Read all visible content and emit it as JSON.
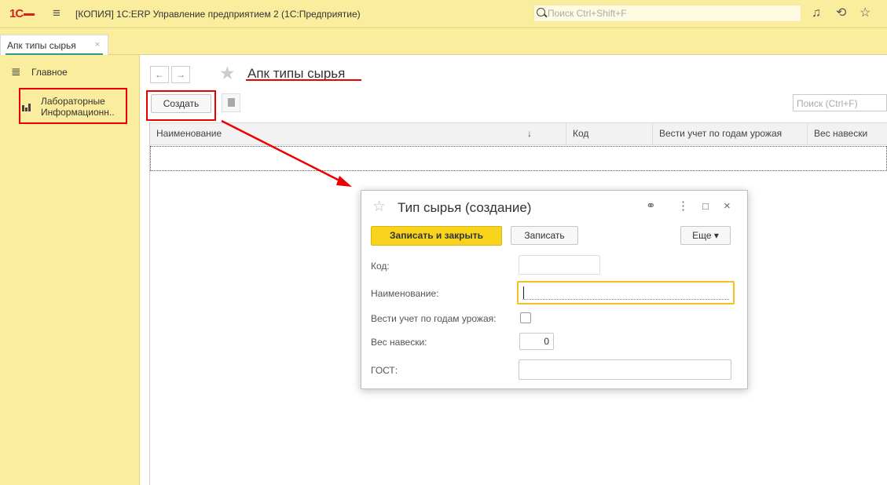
{
  "app": {
    "logo": "1С",
    "title": "[КОПИЯ] 1С:ERP Управление предприятием 2  (1С:Предприятие)",
    "search_placeholder": "Поиск Ctrl+Shift+F"
  },
  "tabs": [
    {
      "label": "Апк типы сырья",
      "close": "×"
    }
  ],
  "sidebar": {
    "items": [
      {
        "label": "Главное",
        "icon": "menu-icon"
      },
      {
        "label_line1": "Лабораторные",
        "label_line2": "Информационн..",
        "icon": "lab-icon"
      }
    ]
  },
  "list_form": {
    "title": "Апк типы сырья",
    "create_button": "Создать",
    "search_placeholder": "Поиск (Ctrl+F)",
    "columns": [
      "Наименование",
      "Код",
      "Вести учет по годам урожая",
      "Вес навески"
    ],
    "sort_indicator": "↓"
  },
  "dialog": {
    "title": "Тип сырья (создание)",
    "save_close_button": "Записать и закрыть",
    "save_button": "Записать",
    "more_button": "Еще ▾",
    "fields": {
      "code_label": "Код:",
      "code_value": "",
      "name_label": "Наименование:",
      "name_value": "",
      "harvest_label": "Вести учет по годам урожая:",
      "harvest_checked": false,
      "weight_label": "Вес навески:",
      "weight_value": "0",
      "gost_label": "ГОСТ:",
      "gost_value": ""
    }
  },
  "colors": {
    "accent_yellow": "#fbed9e",
    "primary_button": "#f7d31c",
    "annotation_red": "#ee0000"
  }
}
